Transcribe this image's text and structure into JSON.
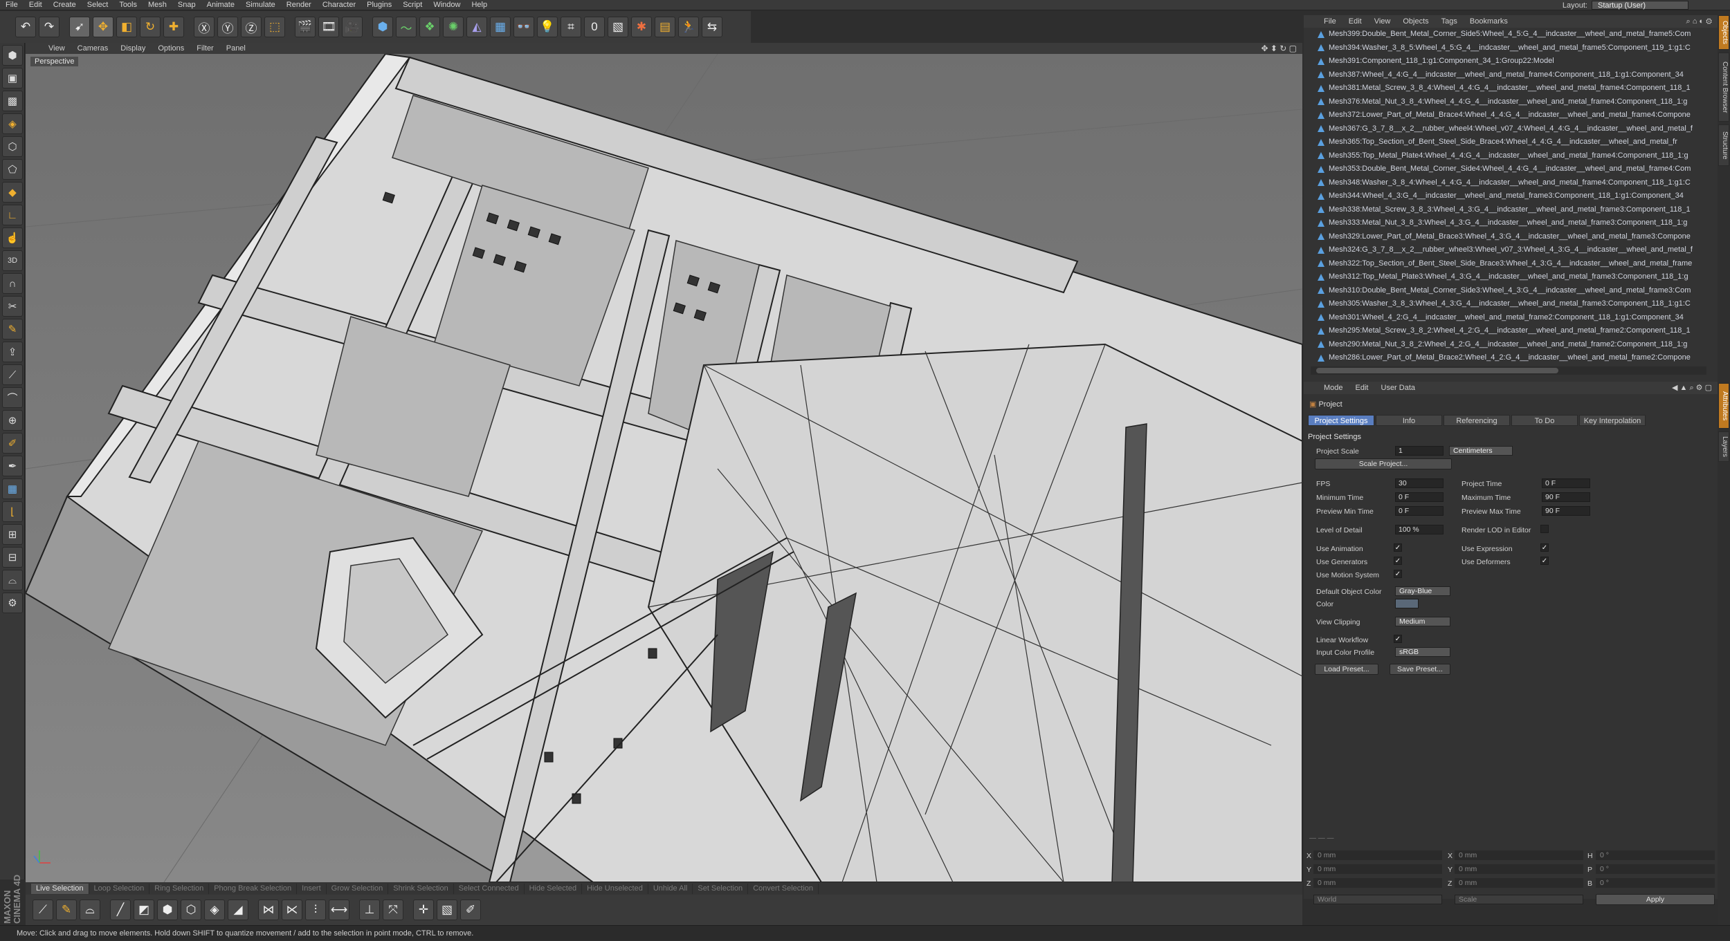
{
  "menubar": {
    "items": [
      "File",
      "Edit",
      "Create",
      "Select",
      "Tools",
      "Mesh",
      "Snap",
      "Animate",
      "Simulate",
      "Render",
      "Character",
      "Plugins",
      "Script",
      "Window",
      "Help"
    ],
    "layout_label": "Layout:",
    "layout_value": "Startup (User)"
  },
  "viewport": {
    "menu": [
      "View",
      "Cameras",
      "Display",
      "Options",
      "Filter",
      "Panel"
    ],
    "label": "Perspective"
  },
  "selection_bar": [
    "Live Selection",
    "Loop Selection",
    "Ring Selection",
    "Phong Break Selection",
    "Insert",
    "Grow Selection",
    "Shrink Selection",
    "Select Connected",
    "Hide Selected",
    "Hide Unselected",
    "Unhide All",
    "Set Selection",
    "Convert Selection"
  ],
  "status": "Move: Click and drag to move elements. Hold down SHIFT to quantize movement / add to the selection in point mode, CTRL to remove.",
  "brand": "MAXON CINEMA 4D",
  "objects": {
    "menu": [
      "File",
      "Edit",
      "View",
      "Objects",
      "Tags",
      "Bookmarks"
    ],
    "items": [
      "Mesh399:Double_Bent_Metal_Corner_Side5:Wheel_4_5:G_4__indcaster__wheel_and_metal_frame5:Com",
      "Mesh394:Washer_3_8_5:Wheel_4_5:G_4__indcaster__wheel_and_metal_frame5:Component_119_1:g1:C",
      "Mesh391:Component_118_1:g1:Component_34_1:Group22:Model",
      "Mesh387:Wheel_4_4:G_4__indcaster__wheel_and_metal_frame4:Component_118_1:g1:Component_34",
      "Mesh381:Metal_Screw_3_8_4:Wheel_4_4:G_4__indcaster__wheel_and_metal_frame4:Component_118_1",
      "Mesh376:Metal_Nut_3_8_4:Wheel_4_4:G_4__indcaster__wheel_and_metal_frame4:Component_118_1:g",
      "Mesh372:Lower_Part_of_Metal_Brace4:Wheel_4_4:G_4__indcaster__wheel_and_metal_frame4:Compone",
      "Mesh367:G_3_7_8__x_2__rubber_wheel4:Wheel_v07_4:Wheel_4_4:G_4__indcaster__wheel_and_metal_f",
      "Mesh365:Top_Section_of_Bent_Steel_Side_Brace4:Wheel_4_4:G_4__indcaster__wheel_and_metal_fr",
      "Mesh355:Top_Metal_Plate4:Wheel_4_4:G_4__indcaster__wheel_and_metal_frame4:Component_118_1:g",
      "Mesh353:Double_Bent_Metal_Corner_Side4:Wheel_4_4:G_4__indcaster__wheel_and_metal_frame4:Com",
      "Mesh348:Washer_3_8_4:Wheel_4_4:G_4__indcaster__wheel_and_metal_frame4:Component_118_1:g1:C",
      "Mesh344:Wheel_4_3:G_4__indcaster__wheel_and_metal_frame3:Component_118_1:g1:Component_34",
      "Mesh338:Metal_Screw_3_8_3:Wheel_4_3:G_4__indcaster__wheel_and_metal_frame3:Component_118_1",
      "Mesh333:Metal_Nut_3_8_3:Wheel_4_3:G_4__indcaster__wheel_and_metal_frame3:Component_118_1:g",
      "Mesh329:Lower_Part_of_Metal_Brace3:Wheel_4_3:G_4__indcaster__wheel_and_metal_frame3:Compone",
      "Mesh324:G_3_7_8__x_2__rubber_wheel3:Wheel_v07_3:Wheel_4_3:G_4__indcaster__wheel_and_metal_f",
      "Mesh322:Top_Section_of_Bent_Steel_Side_Brace3:Wheel_4_3:G_4__indcaster__wheel_and_metal_frame",
      "Mesh312:Top_Metal_Plate3:Wheel_4_3:G_4__indcaster__wheel_and_metal_frame3:Component_118_1:g",
      "Mesh310:Double_Bent_Metal_Corner_Side3:Wheel_4_3:G_4__indcaster__wheel_and_metal_frame3:Com",
      "Mesh305:Washer_3_8_3:Wheel_4_3:G_4__indcaster__wheel_and_metal_frame3:Component_118_1:g1:C",
      "Mesh301:Wheel_4_2:G_4__indcaster__wheel_and_metal_frame2:Component_118_1:g1:Component_34",
      "Mesh295:Metal_Screw_3_8_2:Wheel_4_2:G_4__indcaster__wheel_and_metal_frame2:Component_118_1",
      "Mesh290:Metal_Nut_3_8_2:Wheel_4_2:G_4__indcaster__wheel_and_metal_frame2:Component_118_1:g",
      "Mesh286:Lower_Part_of_Metal_Brace2:Wheel_4_2:G_4__indcaster__wheel_and_metal_frame2:Compone"
    ]
  },
  "attributes": {
    "menu": [
      "Mode",
      "Edit",
      "User Data"
    ],
    "title": "Project",
    "tabs": [
      "Project Settings",
      "Info",
      "Referencing",
      "To Do",
      "Key Interpolation"
    ],
    "section": "Project Settings",
    "project_scale_label": "Project Scale",
    "project_scale_value": "1",
    "project_scale_unit": "Centimeters",
    "scale_project_btn": "Scale Project...",
    "fps_label": "FPS",
    "fps_value": "30",
    "project_time_label": "Project Time",
    "project_time_value": "0 F",
    "min_time_label": "Minimum Time",
    "min_time_value": "0 F",
    "max_time_label": "Maximum Time",
    "max_time_value": "90 F",
    "prev_min_label": "Preview Min Time",
    "prev_min_value": "0 F",
    "prev_max_label": "Preview Max Time",
    "prev_max_value": "90 F",
    "lod_label": "Level of Detail",
    "lod_value": "100 %",
    "render_lod_label": "Render LOD in Editor",
    "use_animation_label": "Use Animation",
    "use_expression_label": "Use Expression",
    "use_generators_label": "Use Generators",
    "use_deformers_label": "Use Deformers",
    "use_motion_label": "Use Motion System",
    "default_color_label": "Default Object Color",
    "default_color_value": "Gray-Blue",
    "color_label": "Color",
    "view_clipping_label": "View Clipping",
    "view_clipping_value": "Medium",
    "linear_workflow_label": "Linear Workflow",
    "input_profile_label": "Input Color Profile",
    "input_profile_value": "sRGB",
    "load_preset": "Load Preset...",
    "save_preset": "Save Preset..."
  },
  "coords": {
    "x_label": "X",
    "y_label": "Y",
    "z_label": "Z",
    "pos": [
      "0 mm",
      "0 mm",
      "0 mm"
    ],
    "size": [
      "0 mm",
      "0 mm",
      "0 mm"
    ],
    "h_label": "H",
    "p_label": "P",
    "b_label": "B",
    "rot": [
      "0 °",
      "0 °",
      "0 °"
    ],
    "world": "World",
    "scale": "Scale",
    "apply": "Apply"
  },
  "right_tabs": [
    "Objects",
    "Content Browser",
    "Structure",
    "Attributes",
    "Layers"
  ],
  "colors": {
    "accent": "#5a7ec0",
    "active_tool": "#e8a020",
    "icon_blue": "#5aa0e0"
  }
}
